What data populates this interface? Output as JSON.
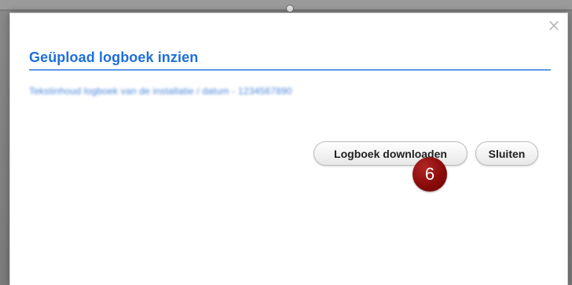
{
  "modal": {
    "title": "Geüpload logboek inzien",
    "blurred_text": "Tekstinhoud logboek van de installatie / datum - 1234567890",
    "buttons": {
      "download_label": "Logboek downloaden",
      "close_label": "Sluiten"
    },
    "close_icon": "×"
  },
  "overlay": {
    "step_badge": "6"
  },
  "colors": {
    "title": "#1e6fd8",
    "title_rule": "#5d99e6",
    "badge": "#8a0b0b"
  }
}
